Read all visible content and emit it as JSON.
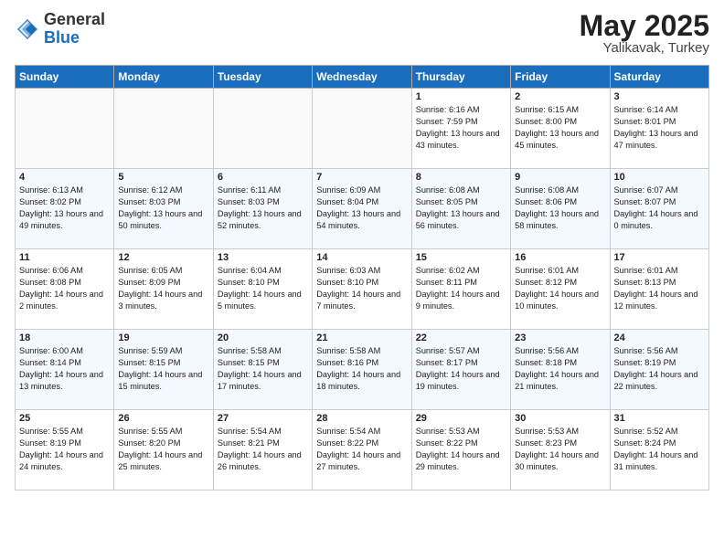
{
  "header": {
    "logo_general": "General",
    "logo_blue": "Blue",
    "title": "May 2025",
    "location": "Yalikavak, Turkey"
  },
  "weekdays": [
    "Sunday",
    "Monday",
    "Tuesday",
    "Wednesday",
    "Thursday",
    "Friday",
    "Saturday"
  ],
  "weeks": [
    [
      {
        "day": "",
        "sunrise": "",
        "sunset": "",
        "daylight": ""
      },
      {
        "day": "",
        "sunrise": "",
        "sunset": "",
        "daylight": ""
      },
      {
        "day": "",
        "sunrise": "",
        "sunset": "",
        "daylight": ""
      },
      {
        "day": "",
        "sunrise": "",
        "sunset": "",
        "daylight": ""
      },
      {
        "day": "1",
        "sunrise": "Sunrise: 6:16 AM",
        "sunset": "Sunset: 7:59 PM",
        "daylight": "Daylight: 13 hours and 43 minutes."
      },
      {
        "day": "2",
        "sunrise": "Sunrise: 6:15 AM",
        "sunset": "Sunset: 8:00 PM",
        "daylight": "Daylight: 13 hours and 45 minutes."
      },
      {
        "day": "3",
        "sunrise": "Sunrise: 6:14 AM",
        "sunset": "Sunset: 8:01 PM",
        "daylight": "Daylight: 13 hours and 47 minutes."
      }
    ],
    [
      {
        "day": "4",
        "sunrise": "Sunrise: 6:13 AM",
        "sunset": "Sunset: 8:02 PM",
        "daylight": "Daylight: 13 hours and 49 minutes."
      },
      {
        "day": "5",
        "sunrise": "Sunrise: 6:12 AM",
        "sunset": "Sunset: 8:03 PM",
        "daylight": "Daylight: 13 hours and 50 minutes."
      },
      {
        "day": "6",
        "sunrise": "Sunrise: 6:11 AM",
        "sunset": "Sunset: 8:03 PM",
        "daylight": "Daylight: 13 hours and 52 minutes."
      },
      {
        "day": "7",
        "sunrise": "Sunrise: 6:09 AM",
        "sunset": "Sunset: 8:04 PM",
        "daylight": "Daylight: 13 hours and 54 minutes."
      },
      {
        "day": "8",
        "sunrise": "Sunrise: 6:08 AM",
        "sunset": "Sunset: 8:05 PM",
        "daylight": "Daylight: 13 hours and 56 minutes."
      },
      {
        "day": "9",
        "sunrise": "Sunrise: 6:08 AM",
        "sunset": "Sunset: 8:06 PM",
        "daylight": "Daylight: 13 hours and 58 minutes."
      },
      {
        "day": "10",
        "sunrise": "Sunrise: 6:07 AM",
        "sunset": "Sunset: 8:07 PM",
        "daylight": "Daylight: 14 hours and 0 minutes."
      }
    ],
    [
      {
        "day": "11",
        "sunrise": "Sunrise: 6:06 AM",
        "sunset": "Sunset: 8:08 PM",
        "daylight": "Daylight: 14 hours and 2 minutes."
      },
      {
        "day": "12",
        "sunrise": "Sunrise: 6:05 AM",
        "sunset": "Sunset: 8:09 PM",
        "daylight": "Daylight: 14 hours and 3 minutes."
      },
      {
        "day": "13",
        "sunrise": "Sunrise: 6:04 AM",
        "sunset": "Sunset: 8:10 PM",
        "daylight": "Daylight: 14 hours and 5 minutes."
      },
      {
        "day": "14",
        "sunrise": "Sunrise: 6:03 AM",
        "sunset": "Sunset: 8:10 PM",
        "daylight": "Daylight: 14 hours and 7 minutes."
      },
      {
        "day": "15",
        "sunrise": "Sunrise: 6:02 AM",
        "sunset": "Sunset: 8:11 PM",
        "daylight": "Daylight: 14 hours and 9 minutes."
      },
      {
        "day": "16",
        "sunrise": "Sunrise: 6:01 AM",
        "sunset": "Sunset: 8:12 PM",
        "daylight": "Daylight: 14 hours and 10 minutes."
      },
      {
        "day": "17",
        "sunrise": "Sunrise: 6:01 AM",
        "sunset": "Sunset: 8:13 PM",
        "daylight": "Daylight: 14 hours and 12 minutes."
      }
    ],
    [
      {
        "day": "18",
        "sunrise": "Sunrise: 6:00 AM",
        "sunset": "Sunset: 8:14 PM",
        "daylight": "Daylight: 14 hours and 13 minutes."
      },
      {
        "day": "19",
        "sunrise": "Sunrise: 5:59 AM",
        "sunset": "Sunset: 8:15 PM",
        "daylight": "Daylight: 14 hours and 15 minutes."
      },
      {
        "day": "20",
        "sunrise": "Sunrise: 5:58 AM",
        "sunset": "Sunset: 8:15 PM",
        "daylight": "Daylight: 14 hours and 17 minutes."
      },
      {
        "day": "21",
        "sunrise": "Sunrise: 5:58 AM",
        "sunset": "Sunset: 8:16 PM",
        "daylight": "Daylight: 14 hours and 18 minutes."
      },
      {
        "day": "22",
        "sunrise": "Sunrise: 5:57 AM",
        "sunset": "Sunset: 8:17 PM",
        "daylight": "Daylight: 14 hours and 19 minutes."
      },
      {
        "day": "23",
        "sunrise": "Sunrise: 5:56 AM",
        "sunset": "Sunset: 8:18 PM",
        "daylight": "Daylight: 14 hours and 21 minutes."
      },
      {
        "day": "24",
        "sunrise": "Sunrise: 5:56 AM",
        "sunset": "Sunset: 8:19 PM",
        "daylight": "Daylight: 14 hours and 22 minutes."
      }
    ],
    [
      {
        "day": "25",
        "sunrise": "Sunrise: 5:55 AM",
        "sunset": "Sunset: 8:19 PM",
        "daylight": "Daylight: 14 hours and 24 minutes."
      },
      {
        "day": "26",
        "sunrise": "Sunrise: 5:55 AM",
        "sunset": "Sunset: 8:20 PM",
        "daylight": "Daylight: 14 hours and 25 minutes."
      },
      {
        "day": "27",
        "sunrise": "Sunrise: 5:54 AM",
        "sunset": "Sunset: 8:21 PM",
        "daylight": "Daylight: 14 hours and 26 minutes."
      },
      {
        "day": "28",
        "sunrise": "Sunrise: 5:54 AM",
        "sunset": "Sunset: 8:22 PM",
        "daylight": "Daylight: 14 hours and 27 minutes."
      },
      {
        "day": "29",
        "sunrise": "Sunrise: 5:53 AM",
        "sunset": "Sunset: 8:22 PM",
        "daylight": "Daylight: 14 hours and 29 minutes."
      },
      {
        "day": "30",
        "sunrise": "Sunrise: 5:53 AM",
        "sunset": "Sunset: 8:23 PM",
        "daylight": "Daylight: 14 hours and 30 minutes."
      },
      {
        "day": "31",
        "sunrise": "Sunrise: 5:52 AM",
        "sunset": "Sunset: 8:24 PM",
        "daylight": "Daylight: 14 hours and 31 minutes."
      }
    ]
  ]
}
